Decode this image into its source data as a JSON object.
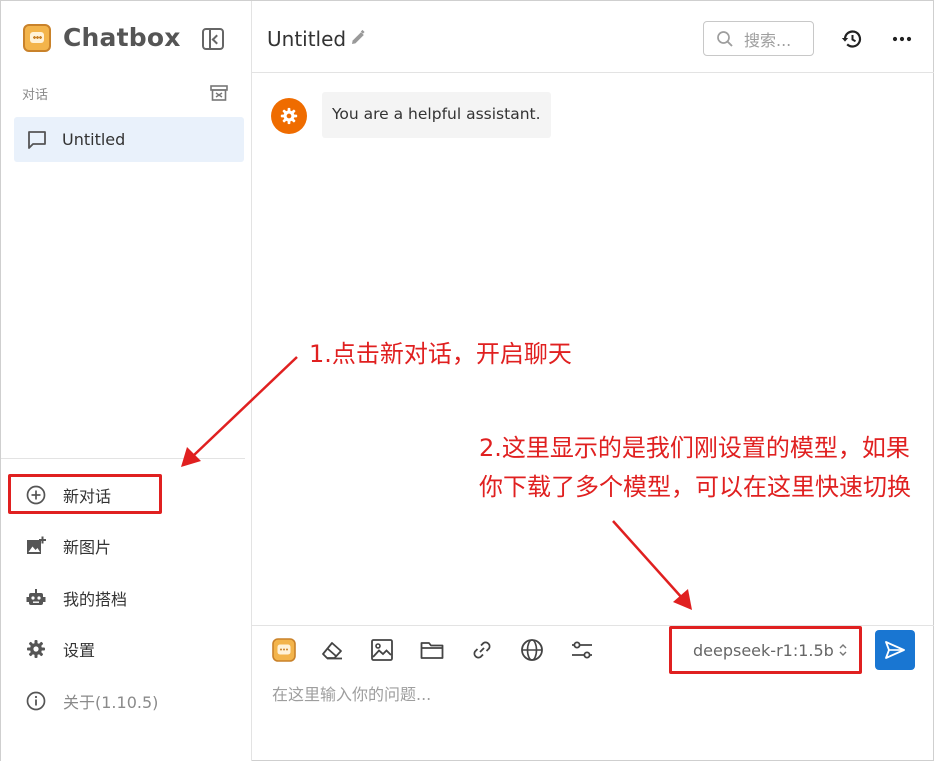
{
  "app": {
    "name": "Chatbox"
  },
  "sidebar": {
    "section_label": "对话",
    "conversations": [
      {
        "title": "Untitled"
      }
    ],
    "menu": {
      "new_chat": "新对话",
      "new_image": "新图片",
      "copilots": "我的搭档",
      "settings": "设置",
      "about": "关于(1.10.5)"
    }
  },
  "header": {
    "title": "Untitled",
    "search_placeholder": "搜索..."
  },
  "messages": [
    {
      "role": "system",
      "text": "You are a helpful assistant."
    }
  ],
  "composer": {
    "model": "deepseek-r1:1.5b",
    "placeholder": "在这里输入你的问题..."
  },
  "annotations": {
    "note_1": "1.点击新对话，开启聊天",
    "note_2": "2.这里显示的是我们刚设置的模型，如果你下载了多个模型，可以在这里快速切换"
  },
  "colors": {
    "accent": "#1976d2",
    "annotation": "#e02020",
    "avatar": "#ef6c00",
    "selected_item": "#e9f1fb"
  }
}
